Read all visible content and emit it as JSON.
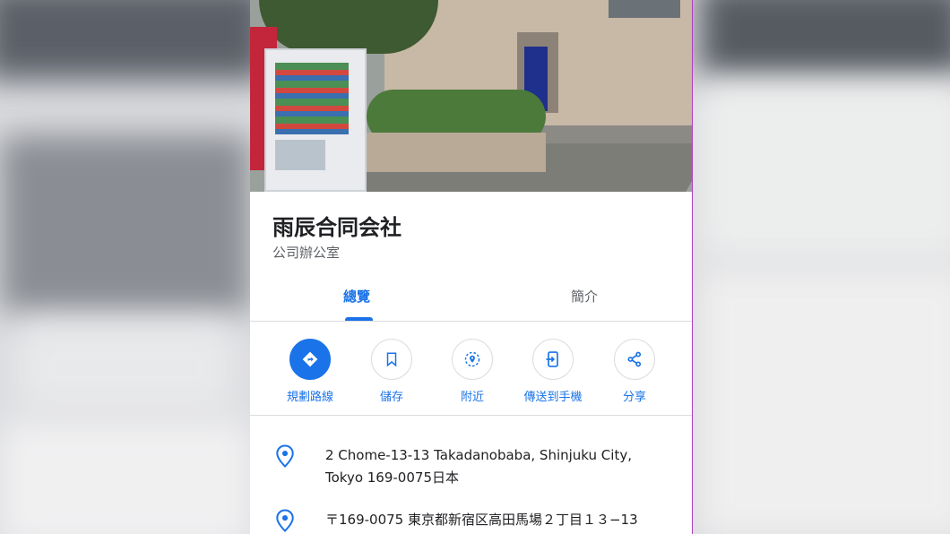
{
  "place": {
    "name": "雨辰合同会社",
    "category": "公司辦公室"
  },
  "tabs": [
    {
      "label": "總覽",
      "active": true
    },
    {
      "label": "簡介",
      "active": false
    }
  ],
  "actions": [
    {
      "label": "規劃路線",
      "icon": "directions-icon"
    },
    {
      "label": "儲存",
      "icon": "bookmark-icon"
    },
    {
      "label": "附近",
      "icon": "nearby-icon"
    },
    {
      "label": "傳送到手機",
      "icon": "send-to-phone-icon"
    },
    {
      "label": "分享",
      "icon": "share-icon"
    }
  ],
  "info": [
    {
      "icon": "location-pin-icon",
      "text": "2 Chome-13-13 Takadanobaba, Shinjuku City, Tokyo 169-0075日本"
    },
    {
      "icon": "location-pin-icon",
      "text": "〒169-0075 東京都新宿区高田馬場２丁目１３−13"
    }
  ],
  "colors": {
    "accent": "#1a73e8",
    "text_primary": "#202124",
    "text_secondary": "#5f6368",
    "divider": "#dadce0"
  }
}
